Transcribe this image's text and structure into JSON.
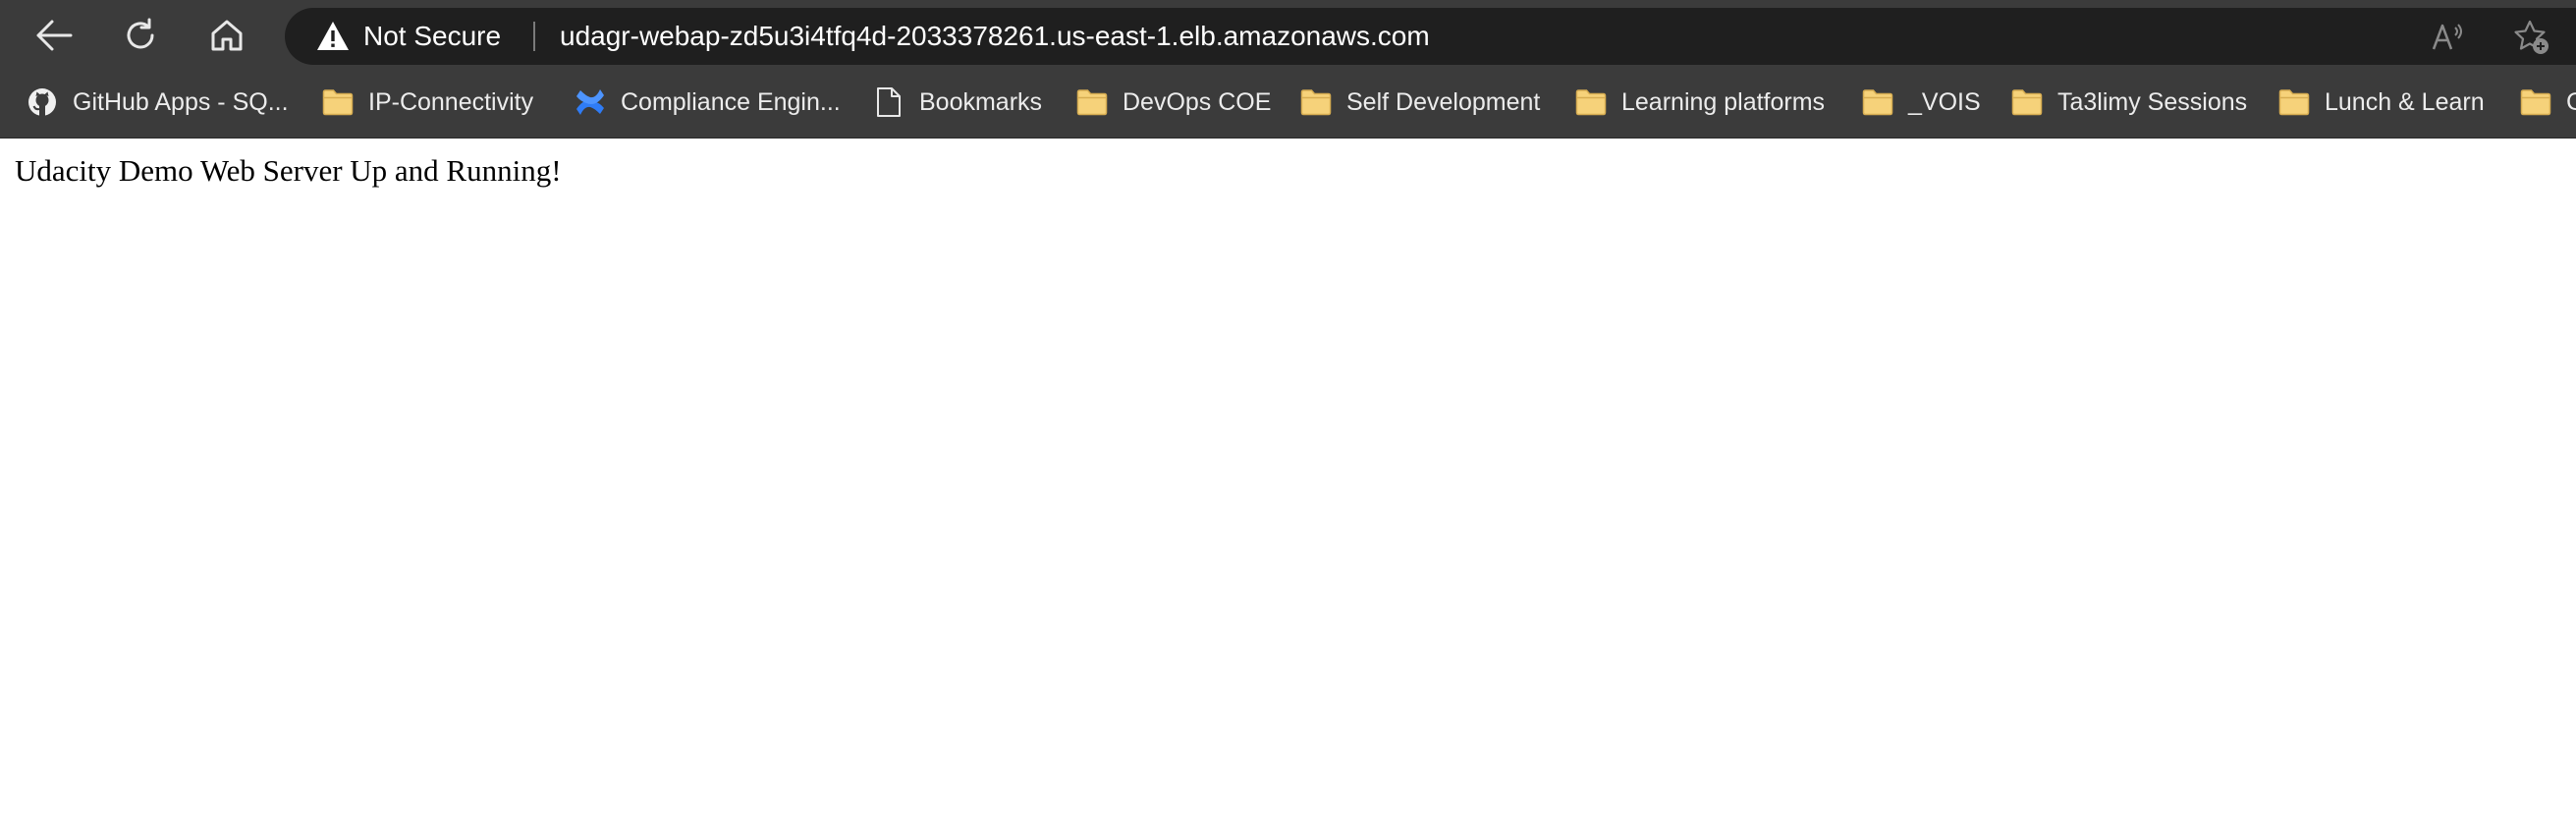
{
  "toolbar": {
    "back_icon": "arrow-left-icon",
    "reload_icon": "reload-icon",
    "home_icon": "home-icon"
  },
  "address_bar": {
    "security_icon": "warning-triangle-icon",
    "security_label": "Not Secure",
    "url": "udagr-webap-zd5u3i4tfq4d-2033378261.us-east-1.elb.amazonaws.com",
    "read_aloud_icon": "read-aloud-icon",
    "favorite_icon": "add-favorite-icon"
  },
  "bookmarks": [
    {
      "label": "GitHub Apps - SQ...",
      "icon": "github-icon"
    },
    {
      "label": "IP-Connectivity",
      "icon": "folder-icon"
    },
    {
      "label": "Compliance Engin...",
      "icon": "confluence-icon"
    },
    {
      "label": "Bookmarks",
      "icon": "page-icon"
    },
    {
      "label": "DevOps COE",
      "icon": "folder-icon"
    },
    {
      "label": "Self Development",
      "icon": "folder-icon"
    },
    {
      "label": "Learning platforms",
      "icon": "folder-icon"
    },
    {
      "label": "_VOIS",
      "icon": "folder-icon"
    },
    {
      "label": "Ta3limy Sessions",
      "icon": "folder-icon"
    },
    {
      "label": "Lunch & Learn",
      "icon": "folder-icon"
    },
    {
      "label": "C",
      "icon": "folder-icon"
    }
  ],
  "page": {
    "text": "Udacity Demo Web Server Up and Running!"
  },
  "colors": {
    "chrome_bg": "#3b3b3b",
    "address_bg": "#1f1f1f",
    "folder_fill": "#f6d27a",
    "confluence_blue": "#2f7cf6",
    "page_bg": "#ffffff"
  }
}
